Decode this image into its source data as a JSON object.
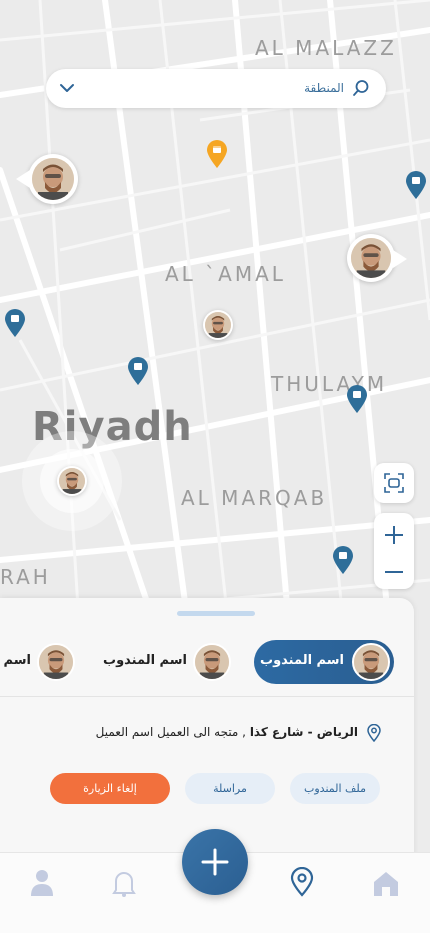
{
  "search": {
    "label": "المنطقة"
  },
  "map": {
    "city": "Riyadh",
    "districts": [
      "AL MALAZZ",
      "AL `AMAL",
      "THULAYM",
      "AL MARQAB",
      "RAH"
    ]
  },
  "agents": [
    {
      "name": "اسم المندوب",
      "selected": true
    },
    {
      "name": "اسم المندوب",
      "selected": false
    },
    {
      "name": "اسم ا",
      "selected": false
    }
  ],
  "visit": {
    "address_bold": "الرياض - شارع كذا",
    "address_rest": " , متجه الى العميل اسم العميل"
  },
  "actions": {
    "profile": "ملف المندوب",
    "message": "مراسلة",
    "cancel": "إلغاء الزيارة"
  },
  "colors": {
    "accent": "#2f6597",
    "danger": "#f2703d",
    "pin_blue": "#2e6e99",
    "pin_orange": "#f5a623"
  }
}
